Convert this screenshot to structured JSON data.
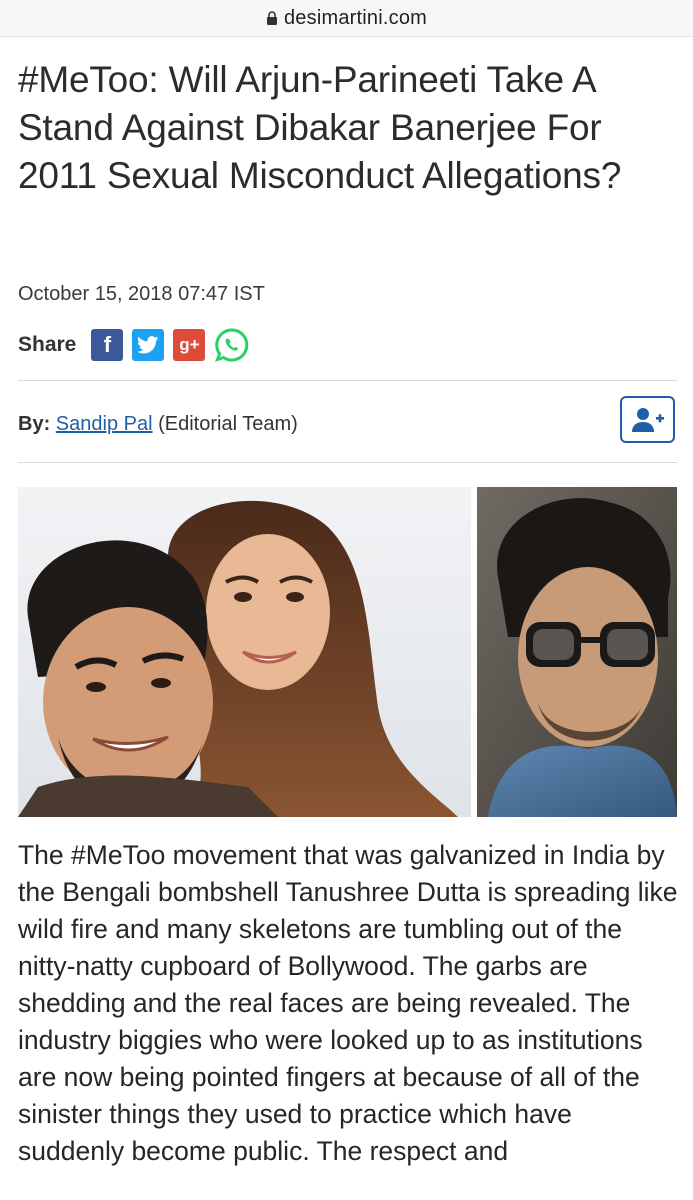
{
  "browser": {
    "url": "desimartini.com"
  },
  "article": {
    "headline": "#MeToo: Will Arjun-Parineeti Take A Stand Against Dibakar Banerjee For 2011 Sexual Misconduct Allegations?",
    "date": "October 15, 2018 07:47 IST",
    "share_label": "Share",
    "share_icons": [
      "facebook-icon",
      "twitter-icon",
      "google-plus-icon",
      "whatsapp-icon"
    ],
    "byline_prefix": "By:",
    "author": "Sandip Pal",
    "author_team": "(Editorial Team)",
    "hero_image_alt": "",
    "body": "The #MeToo movement that was galvanized in India by the Bengali bombshell Tanushree Dutta is spreading like wild fire and many skeletons are tumbling out of the nitty-natty cupboard of Bollywood. The garbs are shedding and the real faces are being revealed. The industry biggies who were looked up to as institutions are now being pointed fingers at because of all of the sinister things they used to practice which have suddenly become public. The respect and"
  },
  "colors": {
    "link": "#1f5fa8",
    "facebook": "#3b5998",
    "twitter": "#1da1f2",
    "google_plus": "#dd4b39",
    "whatsapp": "#25d366"
  }
}
